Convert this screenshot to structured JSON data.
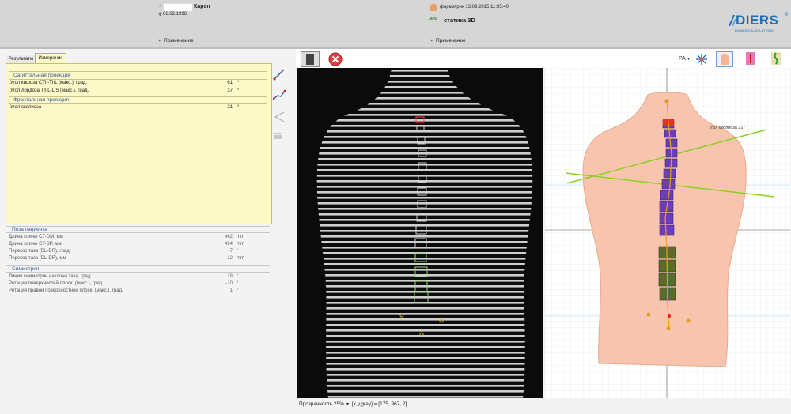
{
  "patient": {
    "name": "Карен",
    "dob": "06.02.1996",
    "note_label": "Примечание"
  },
  "scan": {
    "type_label": "формэтрик 13.09.2015 11:35:40",
    "mode_badge": "3Ds",
    "mode_label": "статика 3D",
    "note_label": "Примечание"
  },
  "brand": {
    "name": "DIERS",
    "tagline": "BIOMEDICAL SOLUTIONS",
    "reg": "®"
  },
  "tabs": [
    {
      "label": "Результаты"
    },
    {
      "label": "Измерения"
    }
  ],
  "measurements": {
    "sagittal_title": "Сагиттальная проекция",
    "rows_sagittal": [
      {
        "label": "Угол кифоза CTh-ThL (макс.), град.",
        "value": "61",
        "unit": "°"
      },
      {
        "label": "Угол лордоза Th L-L S (макс.), град.",
        "value": "37",
        "unit": "°"
      }
    ],
    "frontal_title": "Фронтальная проекция",
    "rows_frontal": [
      {
        "label": "Угол сколиоза",
        "value": "21",
        "unit": "°"
      }
    ]
  },
  "posture": {
    "title": "Поза пациента",
    "rows": [
      {
        "label": "Длина спины C7-DM, мм",
        "value": "462",
        "unit": "mm"
      },
      {
        "label": "Длина спины C7-SP, мм",
        "value": "494",
        "unit": "mm"
      },
      {
        "label": "Перекос таза (DL-DR), град.",
        "value": "-7",
        "unit": "°"
      },
      {
        "label": "Перекос таза (DL-DR), мм",
        "value": "-12",
        "unit": "mm"
      }
    ]
  },
  "symmetry": {
    "title": "Симметрия",
    "rows": [
      {
        "label": "Линия симметрии наклона таза, град.",
        "value": "18",
        "unit": "°"
      },
      {
        "label": "Ротация поверхностей плоск. (макс.), град.",
        "value": "-10",
        "unit": "°"
      },
      {
        "label": "Ротация правой поверхностной плоск. (макс.), град.",
        "value": "1",
        "unit": "°"
      }
    ]
  },
  "view": {
    "pa_label": "PA",
    "scoliosis_annotation": "Угол сколиоза  21°"
  },
  "status": {
    "transparency": "Прозрачность 25%",
    "readout": "[x,y,gray] = [175, 967, 2]"
  },
  "colors": {
    "measure_bg": "#fdf8c7",
    "section_blue": "#3a5a9a",
    "vertebra_purple": "#6a3fb3",
    "vertebra_olive": "#5a6b2a",
    "body_pink": "#f7c5ae",
    "line_green": "#8ccf1f"
  }
}
